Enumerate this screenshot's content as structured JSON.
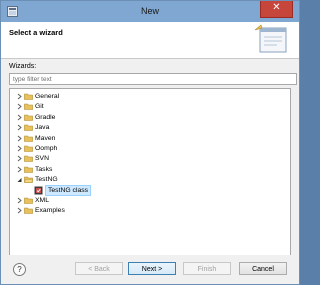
{
  "window": {
    "title": "New",
    "close_glyph": "✕"
  },
  "header": {
    "title": "Select a wizard"
  },
  "wizards": {
    "label": "Wizards:",
    "filter_placeholder": "type filter text"
  },
  "tree": {
    "items": [
      {
        "label": "General",
        "expanded": false
      },
      {
        "label": "Git",
        "expanded": false
      },
      {
        "label": "Gradle",
        "expanded": false
      },
      {
        "label": "Java",
        "expanded": false
      },
      {
        "label": "Maven",
        "expanded": false
      },
      {
        "label": "Oomph",
        "expanded": false
      },
      {
        "label": "SVN",
        "expanded": false
      },
      {
        "label": "Tasks",
        "expanded": false
      },
      {
        "label": "TestNG",
        "expanded": true,
        "children": [
          {
            "label": "TestNG class",
            "selected": true,
            "icon": "testng-class-icon"
          }
        ]
      },
      {
        "label": "XML",
        "expanded": false
      },
      {
        "label": "Examples",
        "expanded": false
      }
    ]
  },
  "footer": {
    "help_glyph": "?",
    "back_label": "< Back",
    "next_label": "Next >",
    "finish_label": "Finish",
    "cancel_label": "Cancel"
  },
  "colors": {
    "titlebar": "#7fa7d2",
    "close": "#c7463c",
    "folder": "#e8c15a",
    "selection": "#cde8ff"
  }
}
